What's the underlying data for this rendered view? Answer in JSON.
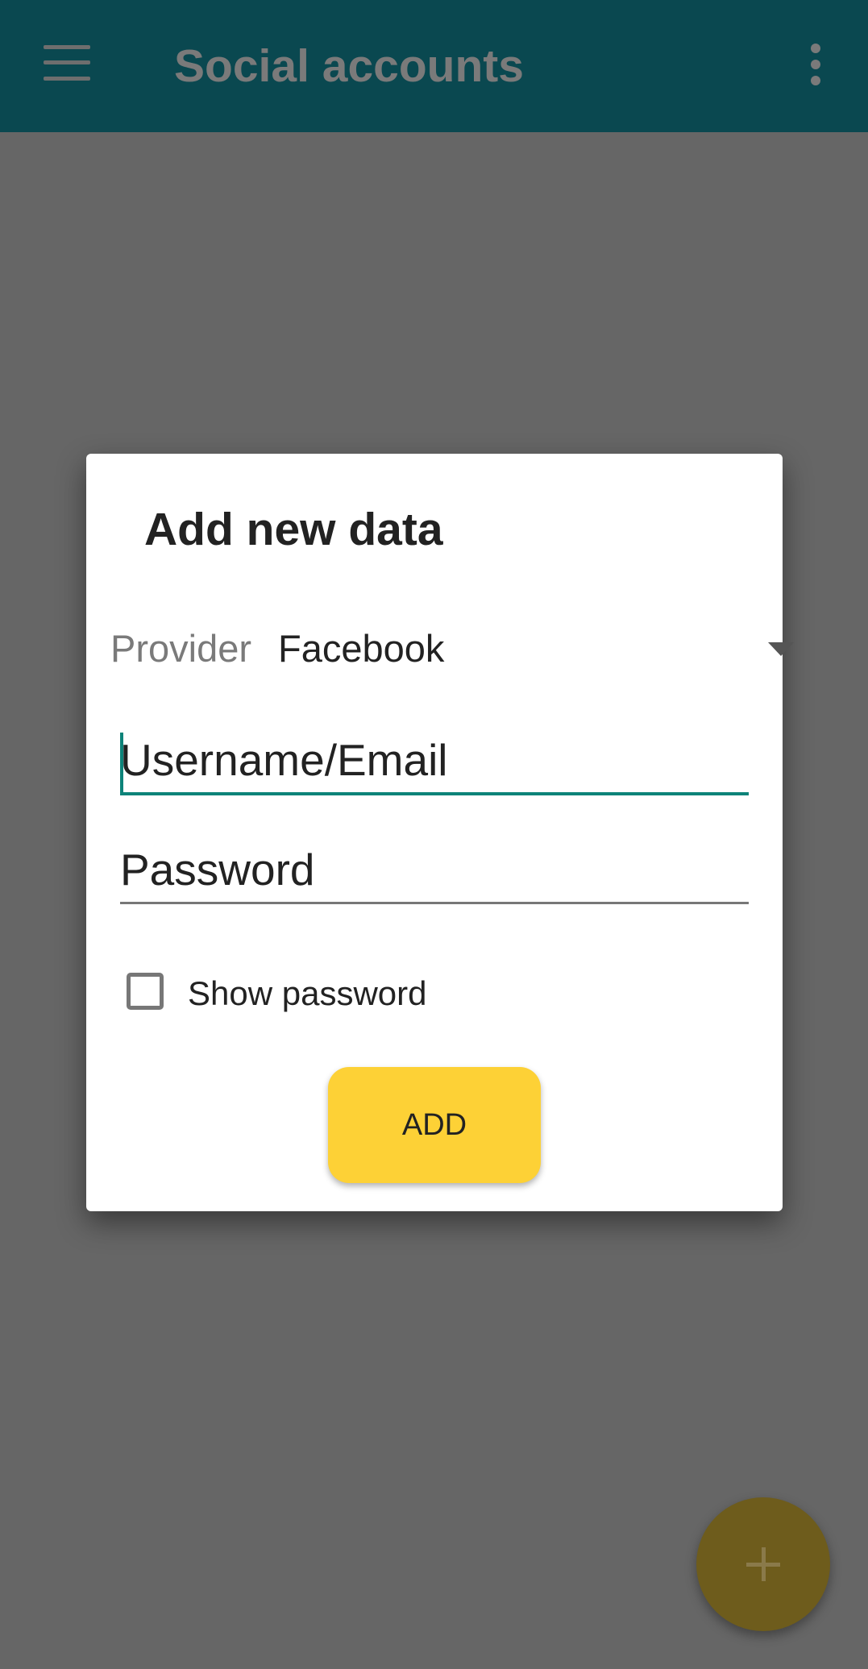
{
  "appbar": {
    "title": "Social accounts",
    "menu_icon": "hamburger-menu-icon",
    "overflow_icon": "more-vert-icon",
    "color": "#0a4850"
  },
  "dialog": {
    "title": "Add new data",
    "provider": {
      "label": "Provider",
      "selected": "Facebook",
      "icon": "dropdown-arrow-icon"
    },
    "username_field": {
      "placeholder": "Username/Email",
      "value": ""
    },
    "password_field": {
      "placeholder": "Password",
      "value": ""
    },
    "show_password": {
      "label": "Show password",
      "checked": false
    },
    "add_button_label": "ADD",
    "accent_color": "#0d8379",
    "button_color": "#fdd136"
  },
  "fab": {
    "icon": "plus-icon"
  }
}
